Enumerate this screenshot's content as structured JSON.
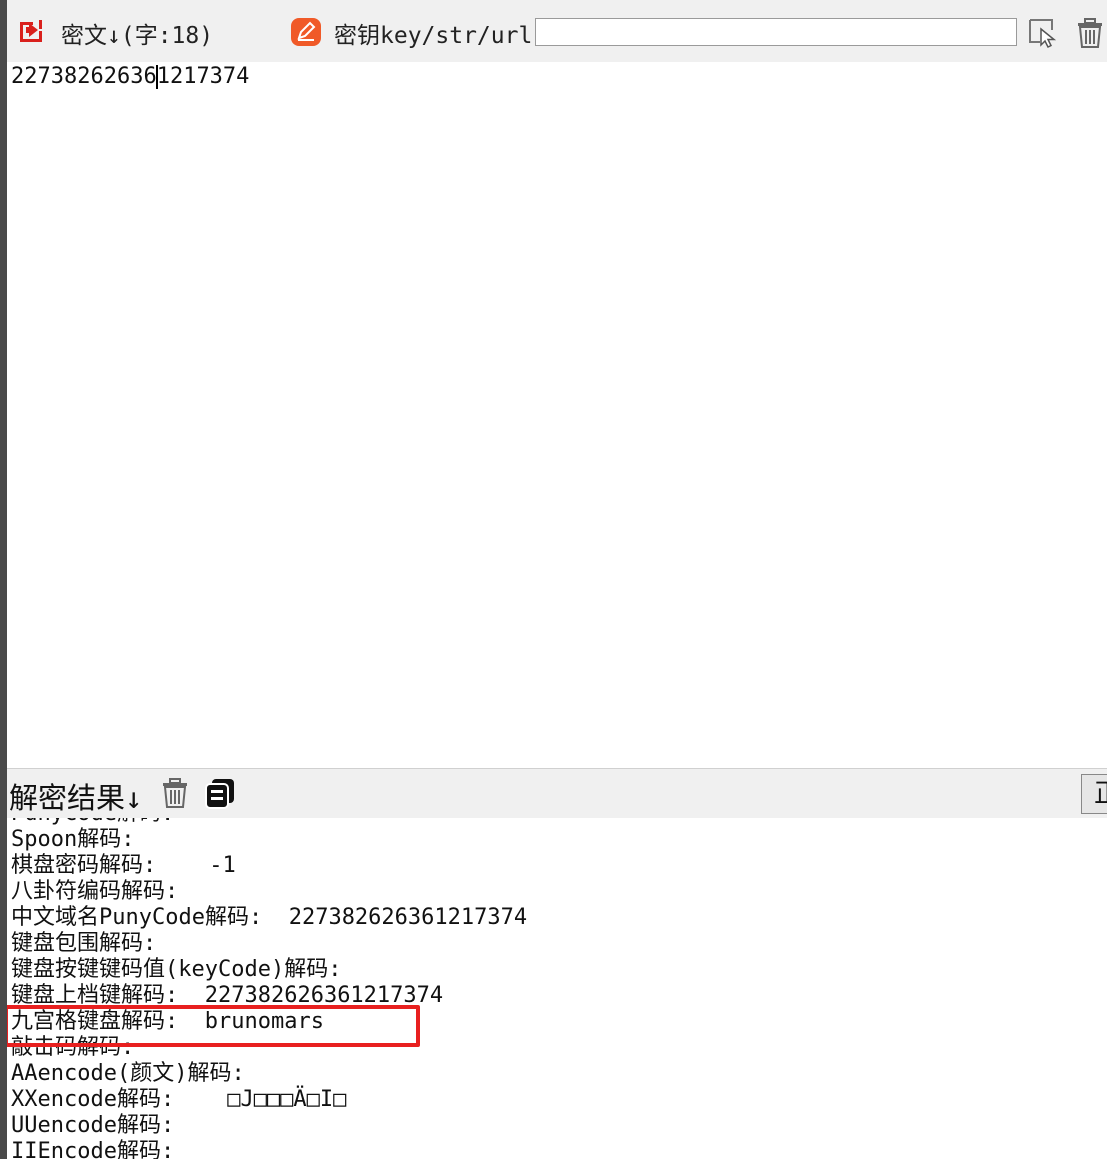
{
  "toolbar": {
    "cipher_label": "密文↓(字:18)",
    "key_label": "密钥key/str/url:",
    "key_value": ""
  },
  "editor": {
    "text_before_caret": "22738262636",
    "text_after_caret": "1217374"
  },
  "result": {
    "title": "解密结果↓",
    "side_button_label": "正",
    "lines": [
      {
        "label": "PunyCode解码:",
        "value": ""
      },
      {
        "label": "Spoon解码:",
        "value": ""
      },
      {
        "label": "棋盘密码解码:",
        "value": "    -1"
      },
      {
        "label": "八卦符编码解码:",
        "value": ""
      },
      {
        "label": "中文域名PunyCode解码:",
        "value": "  227382626361217374"
      },
      {
        "label": "键盘包围解码:",
        "value": ""
      },
      {
        "label": "键盘按键键码值(keyCode)解码:",
        "value": ""
      },
      {
        "label": "键盘上档键解码:",
        "value": "  227382626361217374"
      },
      {
        "label": "九宫格键盘解码:",
        "value": "  brunomars"
      },
      {
        "label": "敲击码解码:",
        "value": ""
      },
      {
        "label": "AAencode(颜文)解码:",
        "value": ""
      },
      {
        "label": "XXencode解码:",
        "value": "    □J□□□Ä□I□"
      },
      {
        "label": "UUencode解码:",
        "value": ""
      },
      {
        "label": "IIEncode解码:",
        "value": ""
      }
    ]
  },
  "colors": {
    "accent_red": "#e8201f",
    "highlight_border": "#e8201f",
    "icon_orange": "#f05a28"
  },
  "icons": {
    "cipher_icon": "import-arrow-icon",
    "key_icon": "edit-pencil-icon",
    "picker_icon": "select-cursor-icon",
    "clear_key_icon": "trash-icon",
    "clear_result_icon": "trash-icon",
    "copy_result_icon": "copy-icon"
  }
}
